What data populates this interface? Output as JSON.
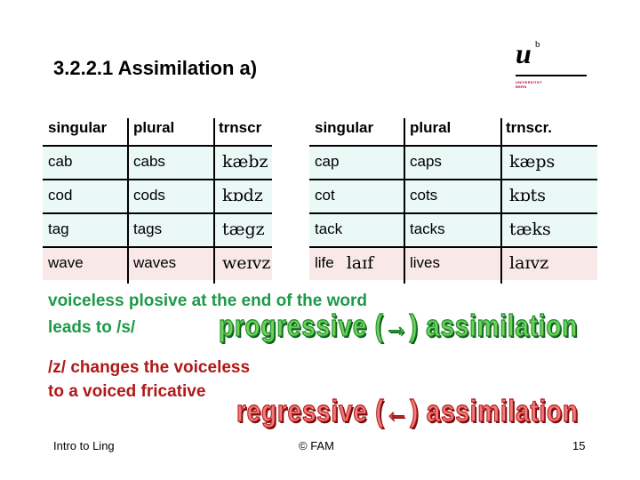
{
  "slide": {
    "title": "3.2.2.1 Assimilation a)",
    "logo": {
      "u": "u",
      "b": "b",
      "line1": "UNIVERSITÄT",
      "line2": "BERN"
    }
  },
  "table": {
    "headers": [
      "singular",
      "plural",
      "trnscr",
      "singular",
      "plural",
      "trnscr."
    ],
    "rows": [
      {
        "sg1": "cab",
        "pl1": "cabs",
        "tr1": "kæbz",
        "sg2": "cap",
        "sg2_ipa": "",
        "pl2": "caps",
        "tr2": "kæps",
        "tone": "teal"
      },
      {
        "sg1": "cod",
        "pl1": "cods",
        "tr1": "kɒdz",
        "sg2": "cot",
        "sg2_ipa": "",
        "pl2": "cots",
        "tr2": "kɒts",
        "tone": "teal"
      },
      {
        "sg1": "tag",
        "pl1": "tags",
        "tr1": "tægz",
        "sg2": "tack",
        "sg2_ipa": "",
        "pl2": "tacks",
        "tr2": "tæks",
        "tone": "teal"
      },
      {
        "sg1": "wave",
        "pl1": "waves",
        "tr1": "weɪvz",
        "sg2": "life",
        "sg2_ipa": "laɪf",
        "pl2": "lives",
        "tr2": "laɪvz",
        "tone": "pink"
      }
    ],
    "colors": {
      "teal": "#eaf8f6",
      "pink": "#f8e8e8"
    }
  },
  "notes": {
    "voiceless_line1": "voiceless plosive at the end of the word",
    "voiceless_line2": "leads to /s/",
    "progressive": "progressive (→) assimilation",
    "z_line1": "/z/ changes the voiceless",
    "z_line2": "to a voiced fricative",
    "regressive": "regressive (←) assimilation",
    "colors": {
      "green": "#1d9a48",
      "red": "#b01818"
    }
  },
  "footer": {
    "left": "Intro to Ling",
    "center": "© FAM",
    "page": "15"
  }
}
